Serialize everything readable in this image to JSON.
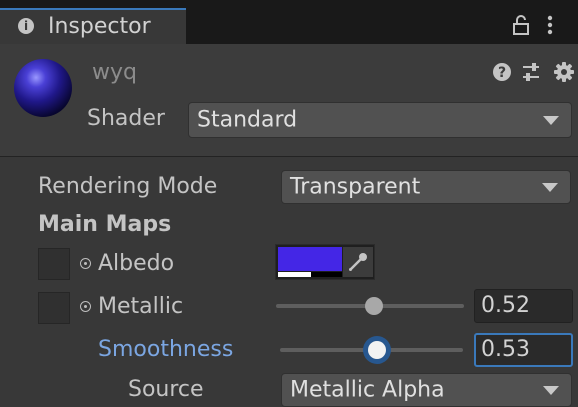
{
  "tab": {
    "icon": "info-icon",
    "title": "Inspector"
  },
  "toolbar": {
    "lock_icon": "lock-icon",
    "menu_icon": "kebab-menu-icon"
  },
  "material": {
    "name": "wyq",
    "shader_label": "Shader",
    "shader_value": "Standard",
    "header_icons": [
      "help-icon",
      "preset-icon",
      "gear-icon"
    ]
  },
  "properties": {
    "rendering_mode": {
      "label": "Rendering Mode",
      "value": "Transparent"
    },
    "main_maps_heading": "Main Maps",
    "albedo": {
      "label": "Albedo",
      "color": "#4426e6",
      "alpha_fraction": 0.52
    },
    "metallic": {
      "label": "Metallic",
      "value": "0.52",
      "fraction": 0.52
    },
    "smoothness": {
      "label": "Smoothness",
      "value": "0.53",
      "fraction": 0.53
    },
    "source": {
      "label": "Source",
      "value": "Metallic Alpha"
    }
  },
  "colors": {
    "accent": "#3a79bb",
    "label_highlight": "#7ba6e2",
    "panel_bg": "#383838"
  }
}
